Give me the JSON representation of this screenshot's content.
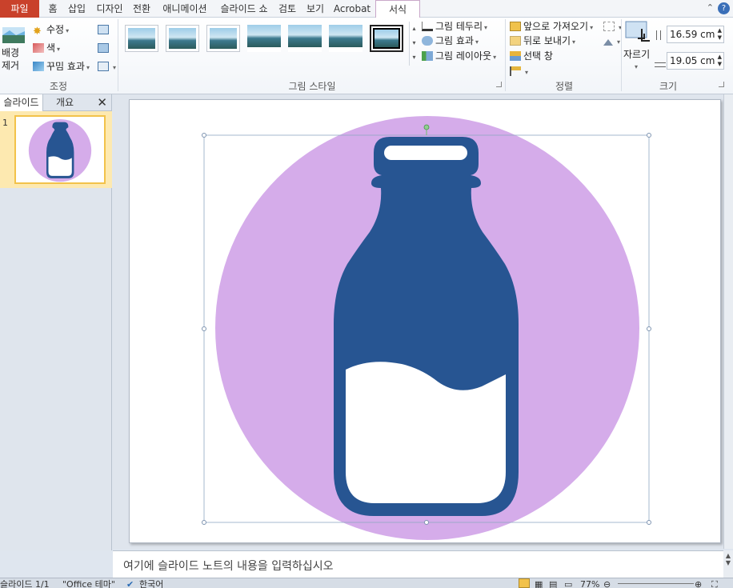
{
  "tabs": [
    {
      "label": "파일",
      "kind": "file"
    },
    {
      "label": "홈"
    },
    {
      "label": "삽입"
    },
    {
      "label": "디자인"
    },
    {
      "label": "전환"
    },
    {
      "label": "애니메이션"
    },
    {
      "label": "슬라이드 쇼"
    },
    {
      "label": "검토"
    },
    {
      "label": "보기"
    },
    {
      "label": "Acrobat"
    },
    {
      "label": "서식",
      "kind": "active"
    }
  ],
  "help_label": "?",
  "ribbon": {
    "adjust": {
      "remove_bg_line1": "배경",
      "remove_bg_line2": "제거",
      "corrections": "수정",
      "color": "색",
      "artistic": "꾸밈 효과",
      "label": "조정"
    },
    "styles": {
      "label": "그림 스타일",
      "border": "그림 테두리",
      "effects": "그림 효과",
      "layout": "그림 레이아웃"
    },
    "arrange": {
      "label": "정렬",
      "bring_forward": "앞으로 가져오기",
      "send_backward": "뒤로 보내기",
      "selection_pane": "선택 창"
    },
    "size": {
      "label": "크기",
      "crop": "자르기",
      "height": "16.59 cm",
      "width": "19.05 cm"
    }
  },
  "left_pane": {
    "tab_slides": "슬라이드",
    "tab_outline": "개요",
    "close": "✕",
    "slide_number": "1"
  },
  "slide": {
    "circle_color": "#d5acea",
    "bottle_color": "#275592"
  },
  "notes_placeholder": "여기에 슬라이드 노트의 내용을 입력하십시오",
  "status": {
    "slide_info": "슬라이드 1/1",
    "theme": "\"Office 테마\"",
    "language": "한국어",
    "zoom": "77%"
  },
  "icons": [
    "remove-background-icon",
    "corrections-icon",
    "color-icon",
    "artistic-effects-icon",
    "compress-icon",
    "change-picture-icon",
    "reset-picture-icon",
    "picture-border-icon",
    "picture-effects-icon",
    "picture-layout-icon",
    "bring-forward-icon",
    "send-backward-icon",
    "selection-pane-icon",
    "align-icon",
    "group-icon",
    "rotate-icon",
    "crop-icon",
    "height-icon",
    "width-icon",
    "spell-check-icon",
    "normal-view-icon",
    "slide-sorter-icon",
    "reading-view-icon",
    "slideshow-icon",
    "zoom-out-icon",
    "zoom-in-icon",
    "fit-window-icon"
  ]
}
